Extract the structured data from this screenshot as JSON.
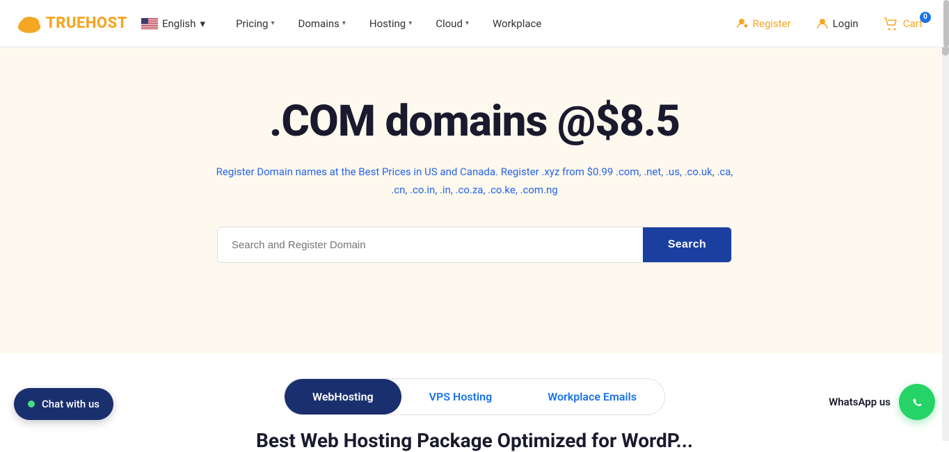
{
  "brand": {
    "name": "TRUEHOST",
    "logo_alt": "Truehost logo"
  },
  "language": {
    "label": "English",
    "flag": "us"
  },
  "nav": {
    "items": [
      {
        "label": "Pricing",
        "has_dropdown": true
      },
      {
        "label": "Domains",
        "has_dropdown": true
      },
      {
        "label": "Hosting",
        "has_dropdown": true
      },
      {
        "label": "Cloud",
        "has_dropdown": true
      },
      {
        "label": "Workplace",
        "has_dropdown": false
      }
    ],
    "register_label": "Register",
    "login_label": "Login",
    "cart_label": "Cart",
    "cart_count": "0"
  },
  "hero": {
    "title": ".COM domains @$8.5",
    "subtitle": "Register Domain names at the Best Prices in US and Canada. Register .xyz from $0.99 .com, .net, .us, .co.uk, .ca, .cn, .co.in, .in, .co.za, .co.ke, .com.ng",
    "search_placeholder": "Search and Register Domain",
    "search_btn": "Search"
  },
  "tabs": {
    "items": [
      {
        "label": "WebHosting",
        "active": true
      },
      {
        "label": "VPS Hosting",
        "active": false
      },
      {
        "label": "Workplace Emails",
        "active": false
      }
    ]
  },
  "bottom": {
    "partial_title": "Best Web Hosting Package Optimized for WordP..."
  },
  "chat": {
    "label": "Chat with us"
  },
  "whatsapp": {
    "label": "WhatsApp us"
  }
}
